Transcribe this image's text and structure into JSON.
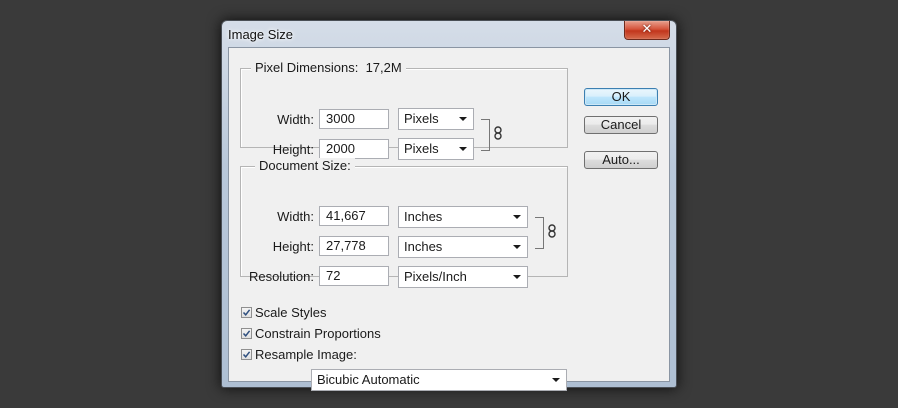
{
  "window": {
    "title": "Image Size",
    "close_glyph": "✕"
  },
  "pixel_dimensions": {
    "legend": "Pixel Dimensions:",
    "total": "17,2M",
    "width": {
      "label": "Width:",
      "value": "3000",
      "unit": "Pixels"
    },
    "height": {
      "label": "Height:",
      "value": "2000",
      "unit": "Pixels"
    }
  },
  "document_size": {
    "legend": "Document Size:",
    "width": {
      "label": "Width:",
      "value": "41,667",
      "unit": "Inches"
    },
    "height": {
      "label": "Height:",
      "value": "27,778",
      "unit": "Inches"
    },
    "resolution": {
      "label": "Resolution:",
      "value": "72",
      "unit": "Pixels/Inch"
    }
  },
  "options": {
    "scale_styles": {
      "label": "Scale Styles",
      "checked": true
    },
    "constrain_proportions": {
      "label": "Constrain Proportions",
      "checked": true
    },
    "resample_image": {
      "label": "Resample Image:",
      "checked": true
    },
    "resample_method": "Bicubic Automatic"
  },
  "buttons": {
    "ok": "OK",
    "cancel": "Cancel",
    "auto": "Auto..."
  }
}
